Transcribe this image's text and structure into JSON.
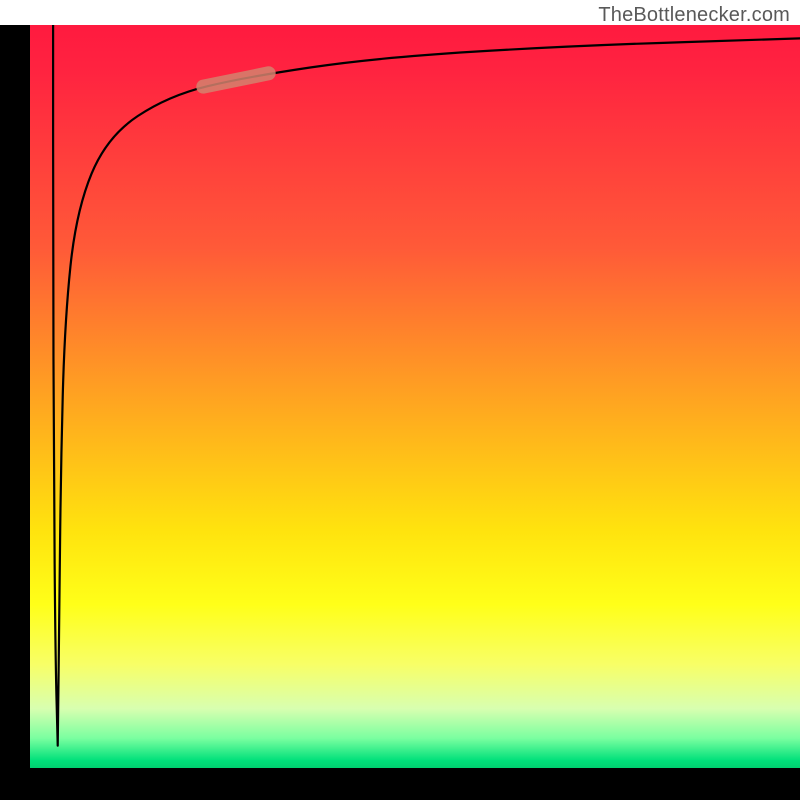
{
  "attribution": "TheBottlenecker.com",
  "chart_data": {
    "type": "line",
    "title": "",
    "xlabel": "",
    "ylabel": "",
    "xlim": [
      0,
      100
    ],
    "ylim": [
      0,
      100
    ],
    "series": [
      {
        "name": "curve-down",
        "points": [
          {
            "x": 3.0,
            "y": 100.0
          },
          {
            "x": 3.0,
            "y": 70.0
          },
          {
            "x": 3.1,
            "y": 40.0
          },
          {
            "x": 3.3,
            "y": 15.0
          },
          {
            "x": 3.6,
            "y": 3.0
          }
        ]
      },
      {
        "name": "curve-up",
        "points": [
          {
            "x": 3.6,
            "y": 3.0
          },
          {
            "x": 3.8,
            "y": 20.0
          },
          {
            "x": 4.0,
            "y": 40.0
          },
          {
            "x": 4.5,
            "y": 60.0
          },
          {
            "x": 6.0,
            "y": 75.0
          },
          {
            "x": 10.0,
            "y": 85.0
          },
          {
            "x": 18.0,
            "y": 90.5
          },
          {
            "x": 28.0,
            "y": 93.0
          },
          {
            "x": 45.0,
            "y": 95.6
          },
          {
            "x": 70.0,
            "y": 97.2
          },
          {
            "x": 100.0,
            "y": 98.2
          }
        ]
      }
    ],
    "highlight_segment": {
      "x_start": 22.5,
      "x_end": 31.0,
      "y_start": 91.7,
      "y_end": 93.5
    },
    "gradient_colors": {
      "top": "#ff1a3f",
      "mid_upper": "#ff8a28",
      "mid": "#ffe30e",
      "mid_lower": "#f0ff55",
      "bottom": "#00d070"
    }
  }
}
